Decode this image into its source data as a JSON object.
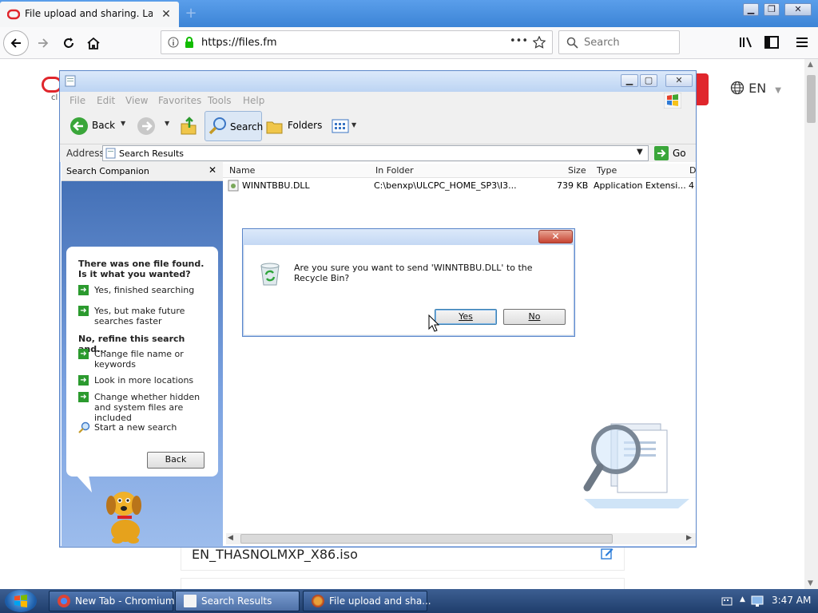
{
  "browser": {
    "tab_title": "File upload and sharing. Large file",
    "tab_close": "✕",
    "new_tab": "+",
    "url": "https://files.fm",
    "search_placeholder": "Search",
    "page_actions": "•••",
    "window_controls": {
      "minimize": "▁",
      "restore": "❐",
      "close": "✕"
    }
  },
  "page": {
    "language": "EN",
    "logo_caption": "cl",
    "file_name": "EN_THASNOLMXP_X86.iso"
  },
  "explorer": {
    "menu": [
      "File",
      "Edit",
      "View",
      "Favorites",
      "Tools",
      "Help"
    ],
    "toolbar": {
      "back": "Back",
      "search": "Search",
      "folders": "Folders"
    },
    "address_label": "Address",
    "address_value": "Search Results",
    "go": "Go",
    "companion_title": "Search Companion",
    "companion": {
      "heading": "There was one file found.  Is it what you wanted?",
      "yes_finished": "Yes, finished searching",
      "yes_future": "Yes, but make future searches faster",
      "refine_heading": "No, refine this search and...",
      "change_name": "Change file name or keywords",
      "more_locations": "Look in more locations",
      "hidden_files": "Change whether hidden and system files are included",
      "new_search": "Start a new search",
      "back_button": "Back"
    },
    "columns": [
      "Name",
      "In Folder",
      "Size",
      "Type",
      "D"
    ],
    "rows": [
      {
        "name": "WINNTBBU.DLL",
        "folder": "C:\\benxp\\ULCPC_HOME_SP3\\I3...",
        "size": "739 KB",
        "type": "Application Extensi...",
        "extra": "4"
      }
    ]
  },
  "dialog": {
    "message": "Are you sure you want to send 'WINNTBBU.DLL' to the Recycle Bin?",
    "yes": "Yes",
    "no": "No",
    "close": "✕"
  },
  "taskbar": {
    "tasks": [
      "New Tab - Chromium",
      "Search Results",
      "File upload and sha..."
    ],
    "clock": "3:47 AM"
  }
}
